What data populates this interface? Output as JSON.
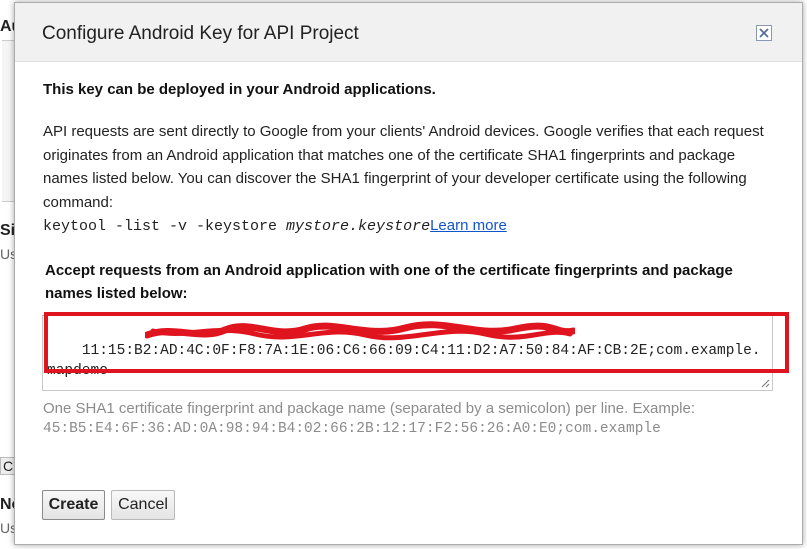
{
  "background": {
    "fragments": [
      "Au",
      "Si",
      "Us",
      "C",
      "No",
      "Us"
    ]
  },
  "dialog": {
    "title": "Configure Android Key for API Project",
    "close_icon": "close-icon",
    "lead": "This key can be deployed in your Android applications.",
    "description": "API requests are sent directly to Google from your clients' Android devices. Google verifies that each request originates from an Android application that matches one of the certificate SHA1 fingerprints and package names listed below. You can discover the SHA1 fingerprint of your developer certificate using the following command:",
    "command_prefix": "keytool -list -v -keystore ",
    "command_arg": "mystore.keystore",
    "learn_more": "Learn more",
    "accept_label": "Accept requests from an Android application with one of the certificate fingerprints and package names listed below:",
    "textarea_value": "11:15:B2:AD:4C:0F:F8:7A:1E:06:C6:66:09:C4:11:D2:A7:50:84:AF:CB:2E;com.example.mapdemo",
    "hint": "One SHA1 certificate fingerprint and package name (separated by a semicolon) per line. Example:",
    "example": "45:B5:E4:6F:36:AD:0A:98:94:B4:02:66:2B:12:17:F2:56:26:A0:E0;com.example",
    "create_label": "Create",
    "cancel_label": "Cancel"
  },
  "colors": {
    "highlight_border": "#e0141e",
    "link": "#1155cc",
    "hint_text": "#8c8c8c"
  }
}
